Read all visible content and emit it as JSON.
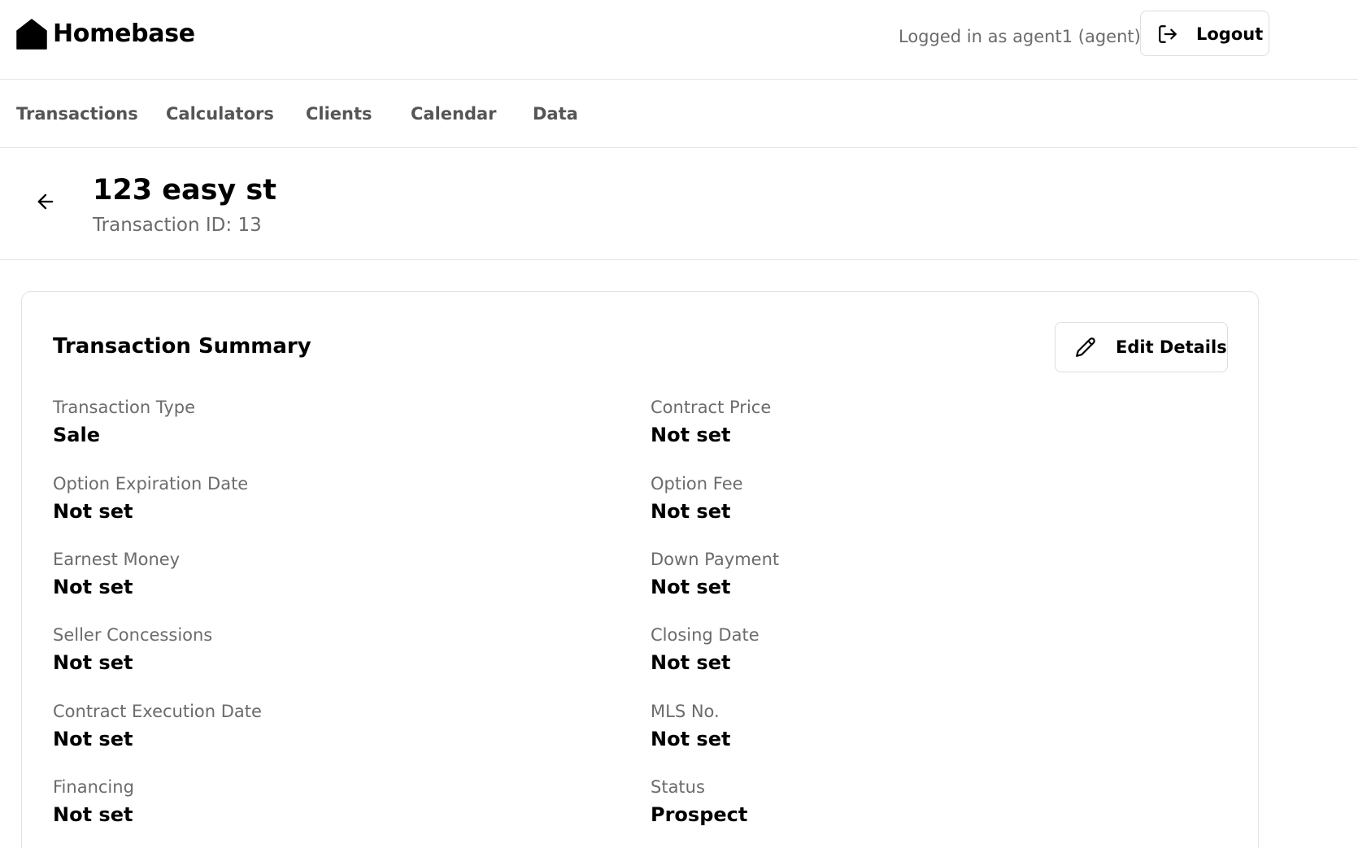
{
  "header": {
    "brand": "Homebase",
    "logged_in_text": "Logged in as agent1 (agent)",
    "logout_label": "Logout"
  },
  "nav": {
    "items": [
      {
        "label": "Transactions"
      },
      {
        "label": "Calculators"
      },
      {
        "label": "Clients"
      },
      {
        "label": "Calendar"
      },
      {
        "label": "Data"
      }
    ]
  },
  "page": {
    "title": "123 easy st",
    "subtitle": "Transaction ID: 13"
  },
  "summary": {
    "title": "Transaction Summary",
    "edit_label": "Edit Details",
    "fields": [
      {
        "label": "Transaction Type",
        "value": "Sale"
      },
      {
        "label": "Contract Price",
        "value": "Not set"
      },
      {
        "label": "Option Expiration Date",
        "value": "Not set"
      },
      {
        "label": "Option Fee",
        "value": "Not set"
      },
      {
        "label": "Earnest Money",
        "value": "Not set"
      },
      {
        "label": "Down Payment",
        "value": "Not set"
      },
      {
        "label": "Seller Concessions",
        "value": "Not set"
      },
      {
        "label": "Closing Date",
        "value": "Not set"
      },
      {
        "label": "Contract Execution Date",
        "value": "Not set"
      },
      {
        "label": "MLS No.",
        "value": "Not set"
      },
      {
        "label": "Financing",
        "value": "Not set"
      },
      {
        "label": "Status",
        "value": "Prospect"
      }
    ]
  },
  "icons": {
    "logo": "house-icon",
    "logout": "logout-icon",
    "back": "arrow-left-icon",
    "edit": "pencil-icon"
  }
}
